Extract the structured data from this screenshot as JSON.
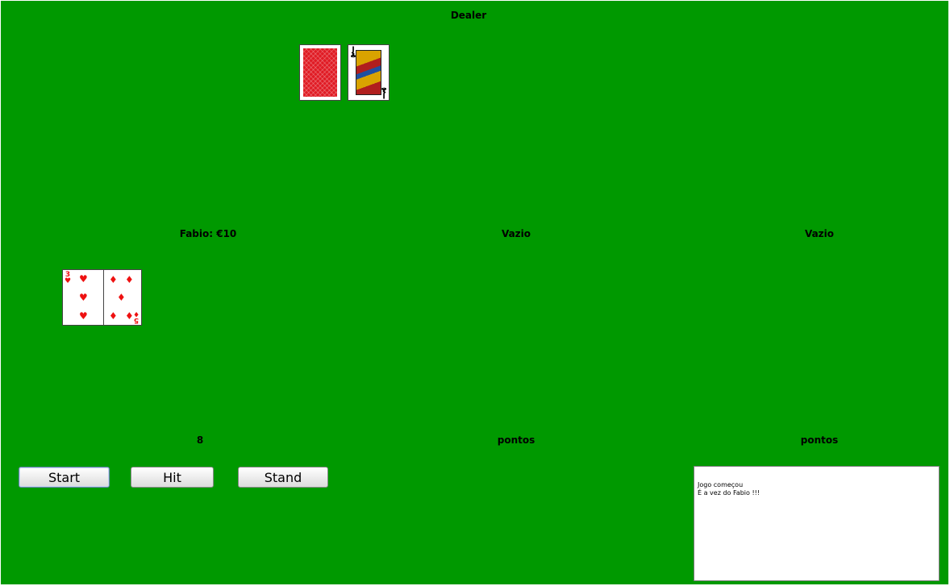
{
  "dealer": {
    "label": "Dealer",
    "cards": [
      {
        "face_down": true
      },
      {
        "rank": "J",
        "suit": "♣",
        "color": "#000000"
      }
    ]
  },
  "players": [
    {
      "label": "Fabio: €10",
      "points": "8",
      "cards": [
        {
          "rank": "3",
          "suit": "♥",
          "color": "#ee1111"
        },
        {
          "rank": "5",
          "suit": "♦",
          "color": "#ee1111"
        }
      ]
    },
    {
      "label": "Vazio",
      "points": "pontos",
      "cards": []
    },
    {
      "label": "Vazio",
      "points": "pontos",
      "cards": []
    }
  ],
  "controls": {
    "start_label": "Start",
    "hit_label": "Hit",
    "stand_label": "Stand"
  },
  "log": {
    "lines": [
      "Jogo começou",
      "É a vez do Fabio !!!"
    ]
  },
  "colors": {
    "table": "#009900",
    "card_back": "#e01b24"
  }
}
